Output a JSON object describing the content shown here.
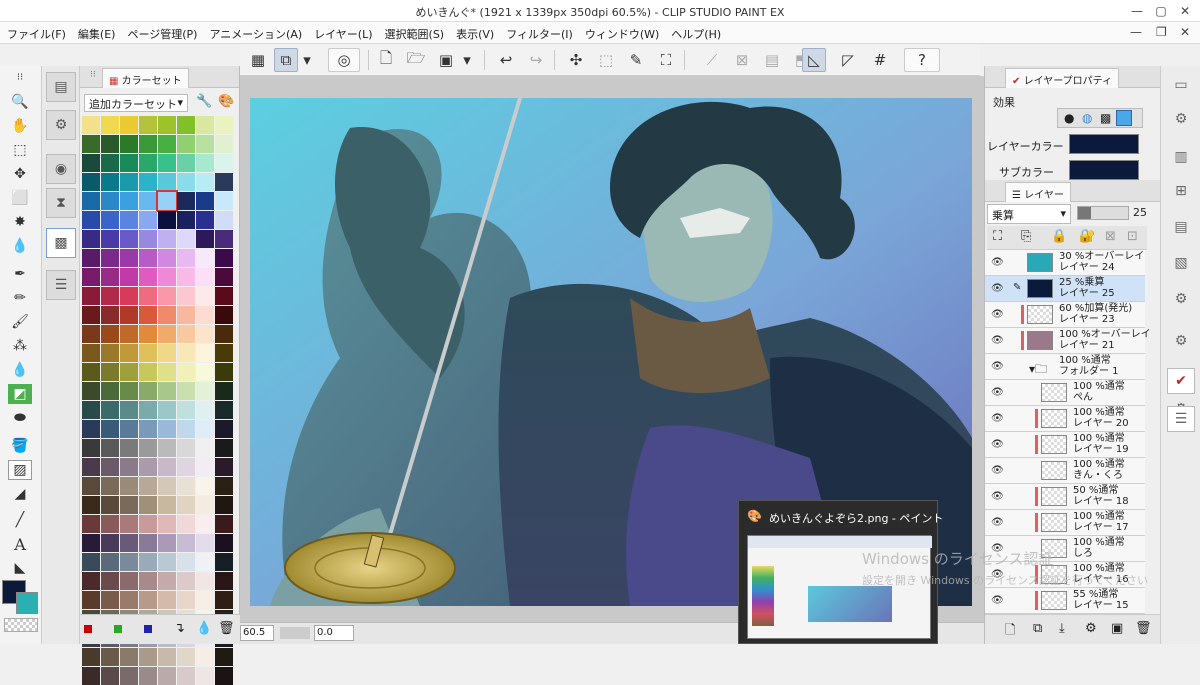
{
  "window": {
    "title": "めいきんぐ* (1921 x 1339px 350dpi 60.5%) - CLIP STUDIO PAINT EX",
    "minimize": "—",
    "maximize": "▢",
    "close": "✕"
  },
  "menu": {
    "items": [
      "ファイル(F)",
      "編集(E)",
      "ページ管理(P)",
      "アニメーション(A)",
      "レイヤー(L)",
      "選択範囲(S)",
      "表示(V)",
      "フィルター(I)",
      "ウィンドウ(W)",
      "ヘルプ(H)"
    ],
    "minimize": "—",
    "restore": "❐",
    "close": "✕"
  },
  "color_panel": {
    "tab_label": "カラーセット",
    "set_name": "追加カラーセット",
    "swatch_colors": [
      "#f3e08a",
      "#f0d850",
      "#eaca30",
      "#b4c43a",
      "#9ec22a",
      "#82c02a",
      "#d8e8a0",
      "#eaf2c0",
      "#3a6a2a",
      "#2a5a2a",
      "#2a7a2a",
      "#3a9a3a",
      "#48b040",
      "#90d070",
      "#b8e0a0",
      "#e0f0d0",
      "#1a4a3a",
      "#1a6a4a",
      "#1a8a5a",
      "#2aa86a",
      "#3ac08a",
      "#6ad0a8",
      "#a8e8d0",
      "#d8f4ec",
      "#0a5a6a",
      "#0a7a8a",
      "#1a9aaa",
      "#2ab4c8",
      "#5ac8d8",
      "#8adce8",
      "#b8ecf4",
      "#2a3a5a",
      "#1a6aa8",
      "#2a88c8",
      "#3aa0e0",
      "#6ab8f0",
      "#98d0f8",
      "#1a2a5a",
      "#1a3a8a",
      "#c8e8fc",
      "#2a4aa8",
      "#3a64c8",
      "#5a84e0",
      "#88a8f0",
      "#0a1040",
      "#1a2060",
      "#2a3090",
      "#d0dcf8",
      "#3a2a88",
      "#4a3aa8",
      "#6a5ac8",
      "#9888e0",
      "#c0b0f0",
      "#e0d8fc",
      "#2a1a5a",
      "#4a2a7a",
      "#5a1a6a",
      "#7a2a8a",
      "#9a3aa8",
      "#b85ac8",
      "#d088e0",
      "#e8b8f0",
      "#f8e8fc",
      "#3a0a4a",
      "#7a1a6a",
      "#9a2a88",
      "#c03aa8",
      "#e05ac0",
      "#f088d8",
      "#f8b8e8",
      "#fcdff4",
      "#4a0a3a",
      "#8a1a3a",
      "#b02a4a",
      "#d83a5a",
      "#f06a80",
      "#f898a8",
      "#fcc8d0",
      "#fde8ec",
      "#5a0a1a",
      "#6a1a1a",
      "#8a2a2a",
      "#b03a2a",
      "#d85a3a",
      "#f08a6a",
      "#f8b8a0",
      "#fcdcd0",
      "#3a0a0a",
      "#7a3a1a",
      "#9a4a1a",
      "#c06a2a",
      "#e08a3a",
      "#f0aa6a",
      "#f8c8a0",
      "#fce4cc",
      "#4a2a0a",
      "#7a5a1a",
      "#9a7a2a",
      "#c09a3a",
      "#e0c05a",
      "#f0d88a",
      "#f8e8b8",
      "#fcf4dc",
      "#4a3a0a",
      "#5a5a1a",
      "#7a7a2a",
      "#a0a03a",
      "#c8c85a",
      "#e0e08a",
      "#f0f0b8",
      "#f8f8dc",
      "#3a3a0a",
      "#3a4a2a",
      "#4a6a3a",
      "#6a8a4a",
      "#8aaa6a",
      "#a8c88a",
      "#c8e0b0",
      "#e4f0d8",
      "#1a2a1a",
      "#2a4a4a",
      "#3a6a6a",
      "#5a8a8a",
      "#7aaaaa",
      "#9ac8c8",
      "#c0e0e0",
      "#e0f0f0",
      "#1a2a2a",
      "#2a3a5a",
      "#3a5a7a",
      "#5a7a9a",
      "#7a9aba",
      "#9ab8d8",
      "#c0d8ec",
      "#e0ecf8",
      "#1a1a2a",
      "#3a3a3a",
      "#5a5a5a",
      "#7a7a7a",
      "#9a9a9a",
      "#bababa",
      "#d8d8d8",
      "#f0f0f0",
      "#1a1a1a",
      "#4a3a4a",
      "#6a5a6a",
      "#8a7a8a",
      "#aa9aaa",
      "#c8b8c8",
      "#e0d4e0",
      "#f4ecf4",
      "#2a1a2a",
      "#5a4a3a",
      "#7a6a5a",
      "#9a8a7a",
      "#b8a898",
      "#d4c8b8",
      "#e8e0d4",
      "#f8f4ec",
      "#2a2016",
      "#3a2a1a",
      "#5a4a3a",
      "#7a6a5a",
      "#a0907a",
      "#c8b8a0",
      "#e0d4c0",
      "#f4ece0",
      "#201810",
      "#6a3a3a",
      "#8a5a5a",
      "#aa7a7a",
      "#c89a9a",
      "#e0b8b8",
      "#f0d8d8",
      "#f8eeee",
      "#3a1a1a",
      "#2a1a3a",
      "#4a3a5a",
      "#6a5a7a",
      "#8a7a9a",
      "#aa9ab8",
      "#c8bcd4",
      "#e4dcec",
      "#1a1020",
      "#3a4a5a",
      "#5a6a7a",
      "#7a8a9a",
      "#9aaab8",
      "#bac8d4",
      "#d8e0ea",
      "#eef2f6",
      "#161e26",
      "#4a2a2a",
      "#6a4a4a",
      "#8a6a6a",
      "#a88a8a",
      "#c4aaaa",
      "#dccaca",
      "#f0e6e6",
      "#2a1616",
      "#5a3a2a",
      "#7a5a4a",
      "#9a7a6a",
      "#b89a8a",
      "#d4baaa",
      "#e8d6ca",
      "#f8eee8",
      "#2e1e16",
      "#4a4a3a",
      "#6a6a5a",
      "#8a8a7a",
      "#aaaa9a",
      "#c8c8ba",
      "#e0e0d6",
      "#f4f4ee",
      "#22221a",
      "#3a3a4a",
      "#5a5a6a",
      "#7a7a8a",
      "#9a9aaa",
      "#babac8",
      "#d6d6e0",
      "#ececf2",
      "#1a1a22",
      "#4a3a2a",
      "#6a5a4a",
      "#8a7a6a",
      "#aa9a8a",
      "#c8baaa",
      "#e0d6ca",
      "#f4eee6",
      "#201a12",
      "#3a2a2a",
      "#5a4a4a",
      "#7a6a6a",
      "#9a8a8a",
      "#baaaaa",
      "#d8caca",
      "#eee6e6",
      "#1c1414"
    ]
  },
  "toolbar": {
    "buttons": [
      "grid-view",
      "toggle",
      "dropdown",
      "spiral",
      "new-file",
      "open-folder",
      "save",
      "save-dropdown",
      "undo",
      "redo",
      "sparkle",
      "select-frame",
      "pen-select",
      "transform",
      "clear",
      "clear-outside",
      "fill",
      "swap",
      "ruler",
      "ruler-edit",
      "guide",
      "help"
    ]
  },
  "layer_property": {
    "tab_label": "レイヤープロパティ",
    "effect_label": "効果",
    "layer_color_label": "レイヤーカラー",
    "sub_color_label": "サブカラー",
    "layer_color": "#0b1a3a",
    "sub_color": "#0b1a3a"
  },
  "layer_panel": {
    "tab_label": "レイヤー",
    "blend_mode": "乗算",
    "opacity": "25",
    "layers": [
      {
        "line1": "30 %オーバーレイ",
        "line2": "レイヤー 24",
        "thumb": "#2aa8b8",
        "selected": false,
        "red": false,
        "indent": false,
        "folder": false
      },
      {
        "line1": "25 %乗算",
        "line2": "レイヤー 25",
        "thumb": "#0b1a3a",
        "selected": true,
        "red": false,
        "indent": false,
        "folder": false
      },
      {
        "line1": "60 %加算(発光)",
        "line2": "レイヤー 23",
        "thumb": "",
        "selected": false,
        "red": true,
        "indent": false,
        "folder": false
      },
      {
        "line1": "100 %オーバーレイ",
        "line2": "レイヤー 21",
        "thumb": "#9a7a8a",
        "selected": false,
        "red": true,
        "indent": false,
        "folder": false
      },
      {
        "line1": "100 %通常",
        "line2": "フォルダー 1",
        "thumb": "",
        "selected": false,
        "red": false,
        "indent": false,
        "folder": true
      },
      {
        "line1": "100 %通常",
        "line2": "ぺん",
        "thumb": "",
        "selected": false,
        "red": false,
        "indent": true,
        "folder": false
      },
      {
        "line1": "100 %通常",
        "line2": "レイヤー 20",
        "thumb": "",
        "selected": false,
        "red": true,
        "indent": true,
        "folder": false
      },
      {
        "line1": "100 %通常",
        "line2": "レイヤー 19",
        "thumb": "",
        "selected": false,
        "red": true,
        "indent": true,
        "folder": false
      },
      {
        "line1": "100 %通常",
        "line2": "きん・くろ",
        "thumb": "",
        "selected": false,
        "red": false,
        "indent": true,
        "folder": false
      },
      {
        "line1": "50 %通常",
        "line2": "レイヤー 18",
        "thumb": "",
        "selected": false,
        "red": true,
        "indent": true,
        "folder": false
      },
      {
        "line1": "100 %通常",
        "line2": "レイヤー 17",
        "thumb": "",
        "selected": false,
        "red": true,
        "indent": true,
        "folder": false
      },
      {
        "line1": "100 %通常",
        "line2": "しろ",
        "thumb": "",
        "selected": false,
        "red": false,
        "indent": true,
        "folder": false
      },
      {
        "line1": "100 %通常",
        "line2": "レイヤー 16",
        "thumb": "",
        "selected": false,
        "red": true,
        "indent": true,
        "folder": false
      },
      {
        "line1": "55 %通常",
        "line2": "レイヤー 15",
        "thumb": "",
        "selected": false,
        "red": true,
        "indent": true,
        "folder": false
      }
    ]
  },
  "status": {
    "zoom": "60.5",
    "angle": "0.0"
  },
  "taskbar_popup": {
    "title": "めいきんぐよぞら2.png - ペイント"
  },
  "watermark": {
    "line1": "Windows のライセンス認証",
    "line2": "設定を開き Windows のライセンス認証を行ってください"
  },
  "colors": {
    "main_color": "#0b1a3a",
    "sub_color": "#2ab0b0"
  }
}
